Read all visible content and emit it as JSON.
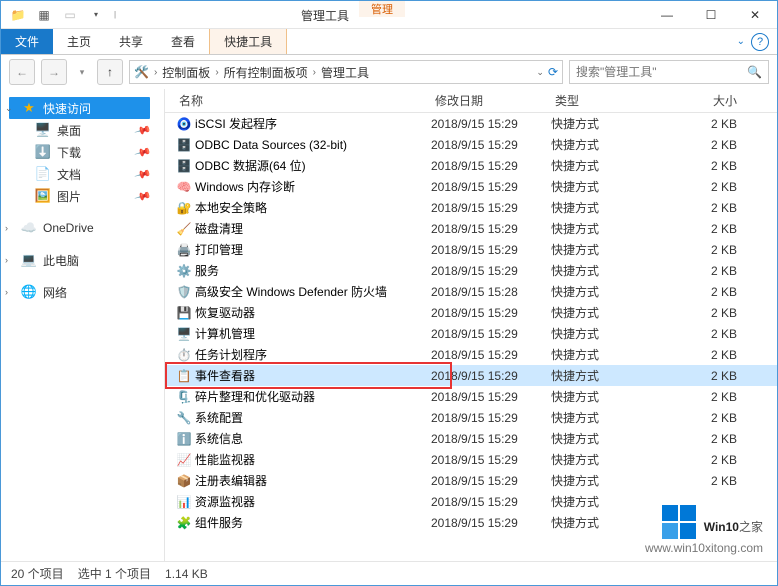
{
  "titlebar": {
    "ctx_header": "管理",
    "window_title": "管理工具"
  },
  "ribbon": {
    "file": "文件",
    "home": "主页",
    "share": "共享",
    "view": "查看",
    "shortcut_tools": "快捷工具"
  },
  "address": {
    "segments": [
      "控制面板",
      "所有控制面板项",
      "管理工具"
    ]
  },
  "search": {
    "placeholder": "搜索\"管理工具\""
  },
  "sidebar": {
    "quick_access": "快速访问",
    "desktop": "桌面",
    "downloads": "下载",
    "documents": "文档",
    "pictures": "图片",
    "onedrive": "OneDrive",
    "this_pc": "此电脑",
    "network": "网络"
  },
  "columns": {
    "name": "名称",
    "date": "修改日期",
    "type": "类型",
    "size": "大小"
  },
  "files": [
    {
      "name": "iSCSI 发起程序",
      "date": "2018/9/15 15:29",
      "type": "快捷方式",
      "size": "2 KB",
      "icon": "🧿"
    },
    {
      "name": "ODBC Data Sources (32-bit)",
      "date": "2018/9/15 15:29",
      "type": "快捷方式",
      "size": "2 KB",
      "icon": "🗄️"
    },
    {
      "name": "ODBC 数据源(64 位)",
      "date": "2018/9/15 15:29",
      "type": "快捷方式",
      "size": "2 KB",
      "icon": "🗄️"
    },
    {
      "name": "Windows 内存诊断",
      "date": "2018/9/15 15:29",
      "type": "快捷方式",
      "size": "2 KB",
      "icon": "🧠"
    },
    {
      "name": "本地安全策略",
      "date": "2018/9/15 15:29",
      "type": "快捷方式",
      "size": "2 KB",
      "icon": "🔐"
    },
    {
      "name": "磁盘清理",
      "date": "2018/9/15 15:29",
      "type": "快捷方式",
      "size": "2 KB",
      "icon": "🧹"
    },
    {
      "name": "打印管理",
      "date": "2018/9/15 15:29",
      "type": "快捷方式",
      "size": "2 KB",
      "icon": "🖨️"
    },
    {
      "name": "服务",
      "date": "2018/9/15 15:29",
      "type": "快捷方式",
      "size": "2 KB",
      "icon": "⚙️"
    },
    {
      "name": "高级安全 Windows Defender 防火墙",
      "date": "2018/9/15 15:28",
      "type": "快捷方式",
      "size": "2 KB",
      "icon": "🛡️"
    },
    {
      "name": "恢复驱动器",
      "date": "2018/9/15 15:29",
      "type": "快捷方式",
      "size": "2 KB",
      "icon": "💾"
    },
    {
      "name": "计算机管理",
      "date": "2018/9/15 15:29",
      "type": "快捷方式",
      "size": "2 KB",
      "icon": "🖥️"
    },
    {
      "name": "任务计划程序",
      "date": "2018/9/15 15:29",
      "type": "快捷方式",
      "size": "2 KB",
      "icon": "⏱️"
    },
    {
      "name": "事件查看器",
      "date": "2018/9/15 15:29",
      "type": "快捷方式",
      "size": "2 KB",
      "icon": "📋",
      "selected": true,
      "highlighted": true
    },
    {
      "name": "碎片整理和优化驱动器",
      "date": "2018/9/15 15:29",
      "type": "快捷方式",
      "size": "2 KB",
      "icon": "🗜️"
    },
    {
      "name": "系统配置",
      "date": "2018/9/15 15:29",
      "type": "快捷方式",
      "size": "2 KB",
      "icon": "🔧"
    },
    {
      "name": "系统信息",
      "date": "2018/9/15 15:29",
      "type": "快捷方式",
      "size": "2 KB",
      "icon": "ℹ️"
    },
    {
      "name": "性能监视器",
      "date": "2018/9/15 15:29",
      "type": "快捷方式",
      "size": "2 KB",
      "icon": "📈"
    },
    {
      "name": "注册表编辑器",
      "date": "2018/9/15 15:29",
      "type": "快捷方式",
      "size": "2 KB",
      "icon": "📦"
    },
    {
      "name": "资源监视器",
      "date": "2018/9/15 15:29",
      "type": "快捷方式",
      "size": "",
      "icon": "📊"
    },
    {
      "name": "组件服务",
      "date": "2018/9/15 15:29",
      "type": "快捷方式",
      "size": "",
      "icon": "🧩"
    }
  ],
  "status": {
    "item_count": "20 个项目",
    "selection": "选中 1 个项目",
    "sel_size": "1.14 KB"
  },
  "watermark": {
    "brand_main": "Win10",
    "brand_sub": "之家",
    "url": "www.win10xitong.com"
  }
}
